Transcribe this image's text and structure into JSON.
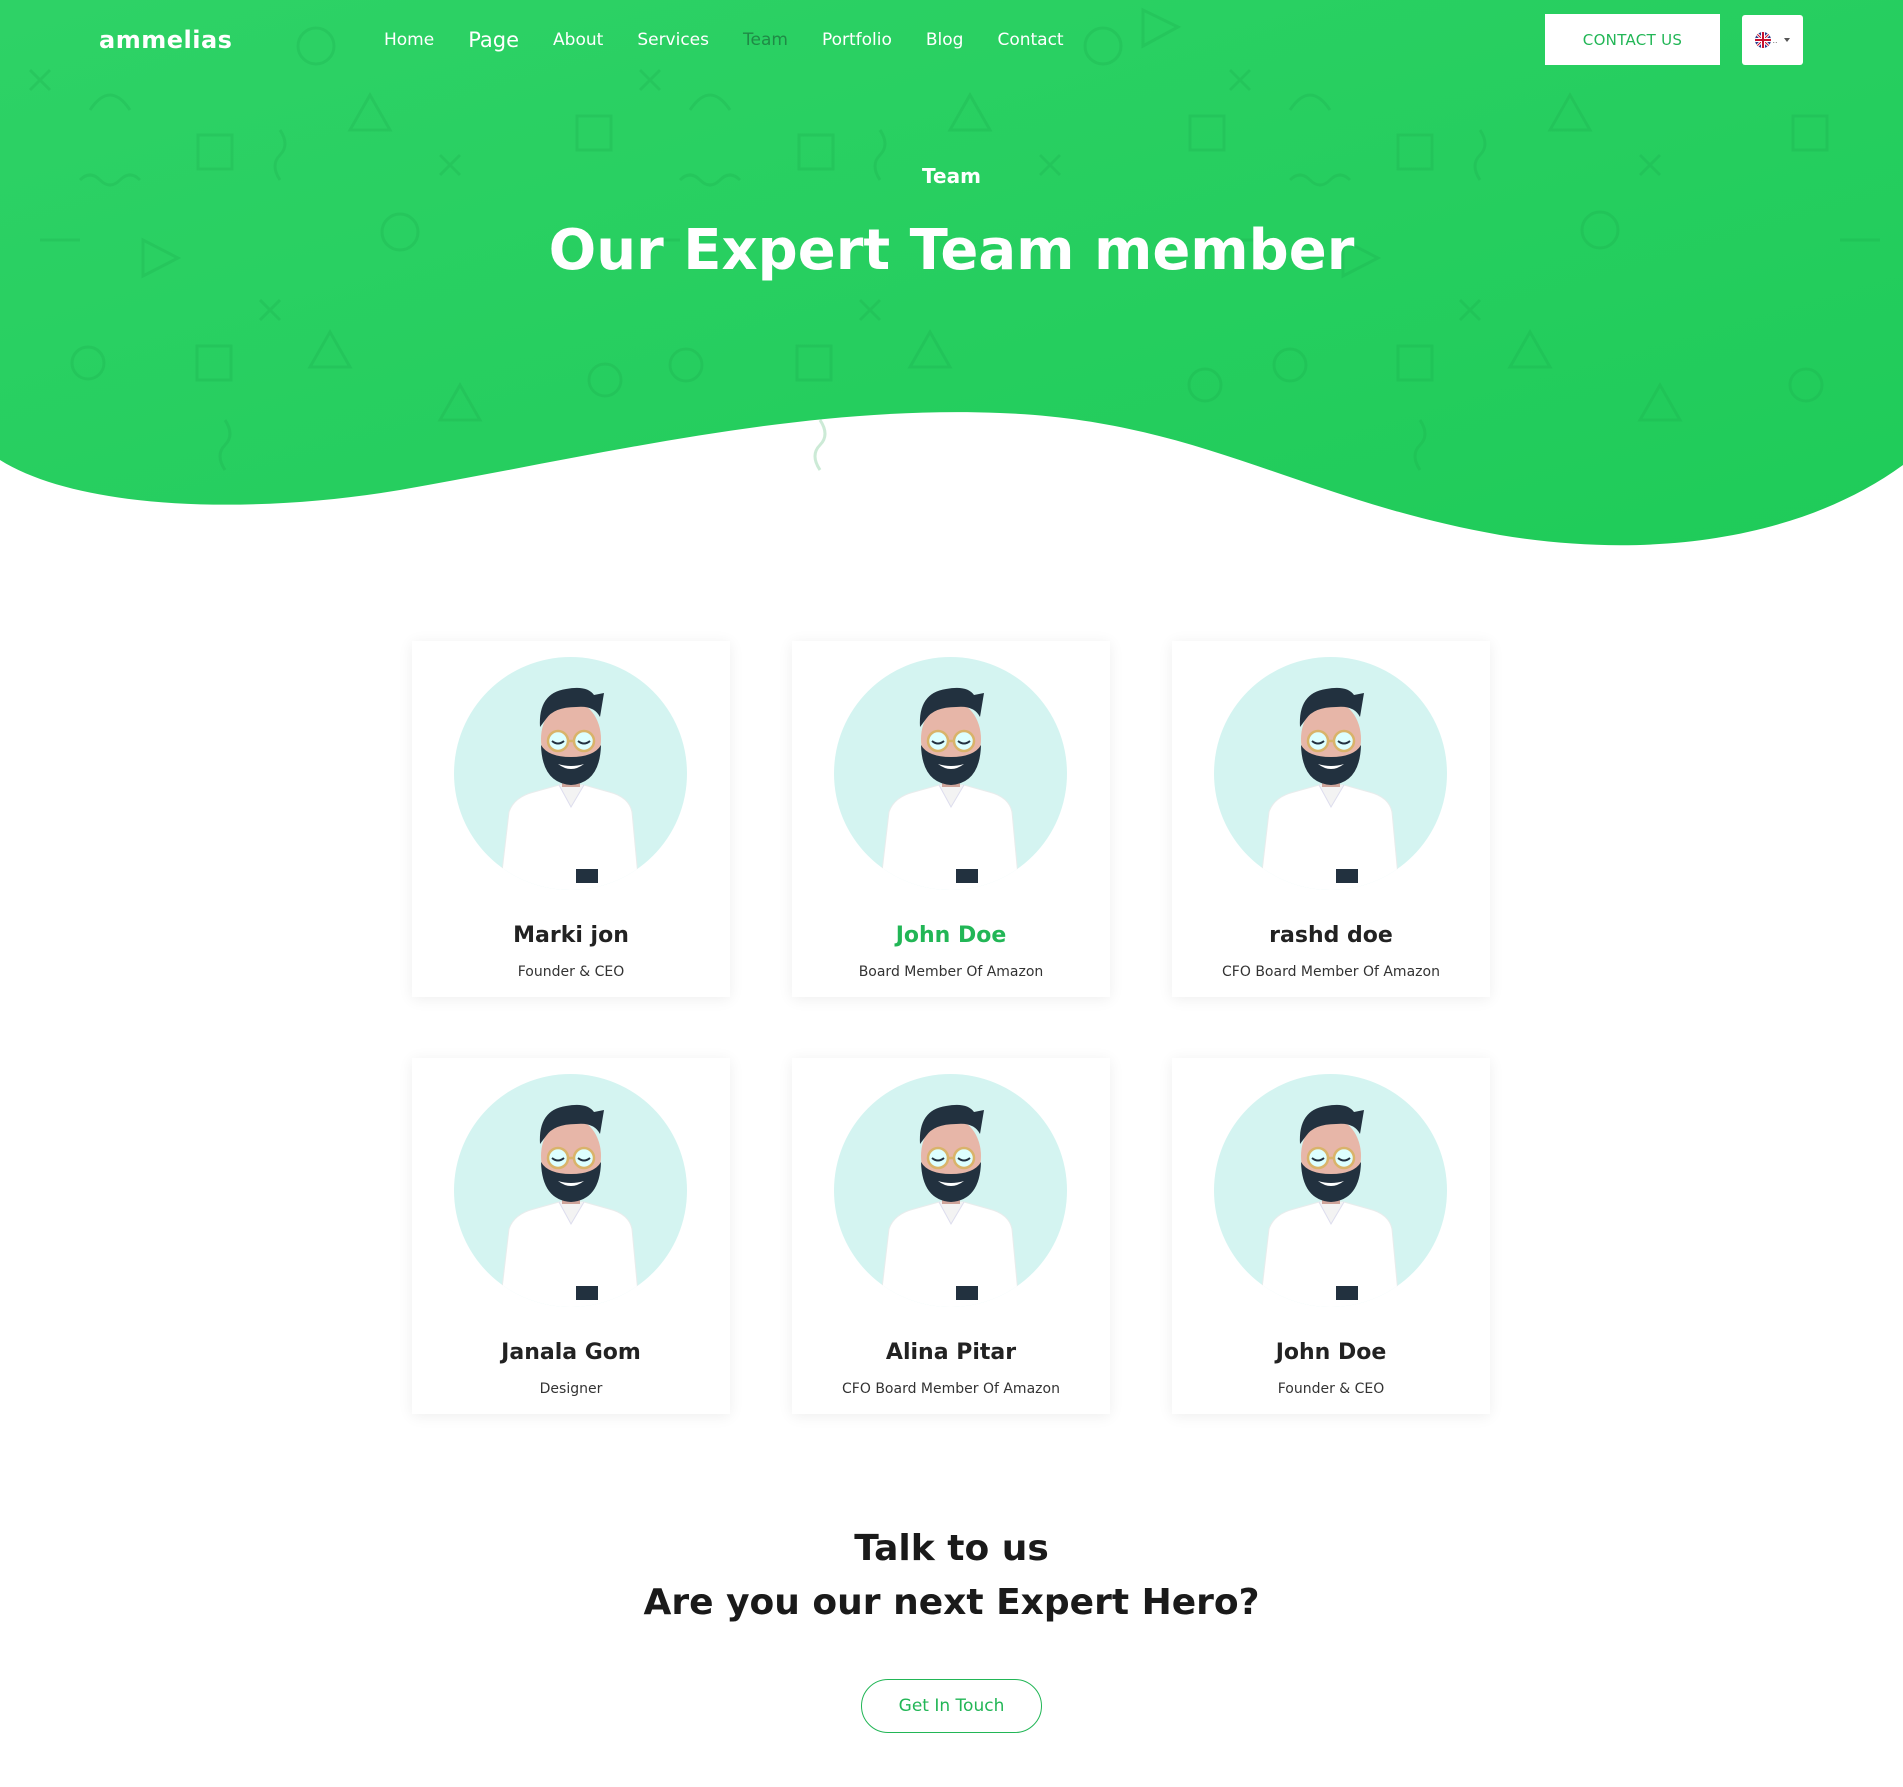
{
  "brand": {
    "logo": "ammelias"
  },
  "nav": {
    "items": [
      {
        "label": "Home",
        "active": false
      },
      {
        "label": "Page",
        "active": false
      },
      {
        "label": "About",
        "active": false
      },
      {
        "label": "Services",
        "active": false
      },
      {
        "label": "Team",
        "active": true
      },
      {
        "label": "Portfolio",
        "active": false
      },
      {
        "label": "Blog",
        "active": false
      },
      {
        "label": "Contact",
        "active": false
      }
    ]
  },
  "header": {
    "contact_label": "CONTACT US",
    "language_icon": "uk-flag-icon"
  },
  "hero": {
    "subtitle": "Team",
    "title": "Our Expert Team member"
  },
  "team": [
    {
      "name": "Marki jon",
      "role": "Founder & CEO",
      "highlight": false
    },
    {
      "name": "John Doe",
      "role": "Board Member Of Amazon",
      "highlight": true
    },
    {
      "name": "rashd doe",
      "role": "CFO Board Member Of Amazon",
      "highlight": false
    },
    {
      "name": "Janala Gom",
      "role": "Designer",
      "highlight": false
    },
    {
      "name": "Alina Pitar",
      "role": "CFO Board Member Of Amazon",
      "highlight": false
    },
    {
      "name": "John Doe",
      "role": "Founder & CEO",
      "highlight": false
    }
  ],
  "cta": {
    "title": "Talk to us",
    "subtitle": "Are you our next Expert Hero?",
    "button_label": "Get In Touch"
  },
  "colors": {
    "brand_green": "#22b656",
    "hero_green": "#25cc5f",
    "avatar_bg": "#d4f4f1",
    "text_dark": "#1a1a1a"
  }
}
